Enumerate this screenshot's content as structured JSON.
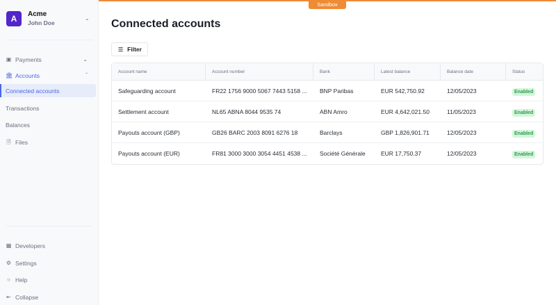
{
  "org": {
    "initial": "A",
    "name": "Acme",
    "user": "John Doe"
  },
  "nav": {
    "payments": "Payments",
    "accounts": "Accounts",
    "connected": "Connected accounts",
    "transactions": "Transactions",
    "balances": "Balances",
    "files": "Files",
    "developers": "Developers",
    "settings": "Settings",
    "help": "Help",
    "collapse": "Collapse"
  },
  "env_badge": "Sandbox",
  "page_title": "Connected accounts",
  "filter_label": "Filter",
  "table": {
    "headers": [
      "Account name",
      "Account number",
      "Bank",
      "Latest balance",
      "Balance date",
      "Status"
    ],
    "rows": [
      [
        "Safeguarding account",
        "FR22 1756 9000 5067 7443 5158 ...",
        "BNP Paribas",
        "EUR 542,750.92",
        "12/05/2023",
        "Enabled"
      ],
      [
        "Settlement account",
        "NL65 ABNA 8044 9535 74",
        "ABN Amro",
        "EUR 4,642,021.50",
        "11/05/2023",
        "Enabled"
      ],
      [
        "Payouts account (GBP)",
        "GB26 BARC 2003 8091 6276 18",
        "Barclays",
        "GBP 1,826,901.71",
        "12/05/2023",
        "Enabled"
      ],
      [
        "Payouts account (EUR)",
        "FR81 3000 3000 3054 4451 4538 ...",
        "Société Générale",
        "EUR 17,750.37",
        "12/05/2023",
        "Enabled"
      ]
    ]
  },
  "colors": {
    "accent": "#4a66e6",
    "sandbox": "#ef8a35",
    "avatar": "#5226c9",
    "enabled_bg": "#d3f5dc",
    "enabled_text": "#2f9a4c"
  }
}
